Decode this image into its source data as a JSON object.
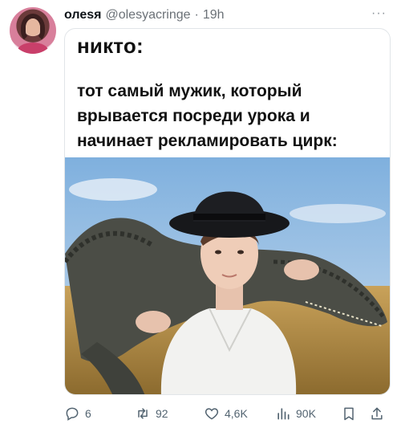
{
  "post": {
    "author_name": "олеsя",
    "author_handle": "@olesyacringe",
    "separator": "·",
    "time": "19h",
    "more_glyph": "···"
  },
  "meme": {
    "heading": "никто:",
    "caption": "тот самый мужик, который врывается посреди урока и начинает рекламировать цирк:"
  },
  "actions": {
    "replies": "6",
    "retweets": "92",
    "likes": "4,6K",
    "views": "90K"
  },
  "colors": {
    "text": "#0f1419",
    "muted": "#536471",
    "border": "#e1e5e8"
  },
  "icons": [
    "reply-icon",
    "retweet-icon",
    "like-icon",
    "views-icon",
    "bookmark-icon",
    "share-icon"
  ]
}
